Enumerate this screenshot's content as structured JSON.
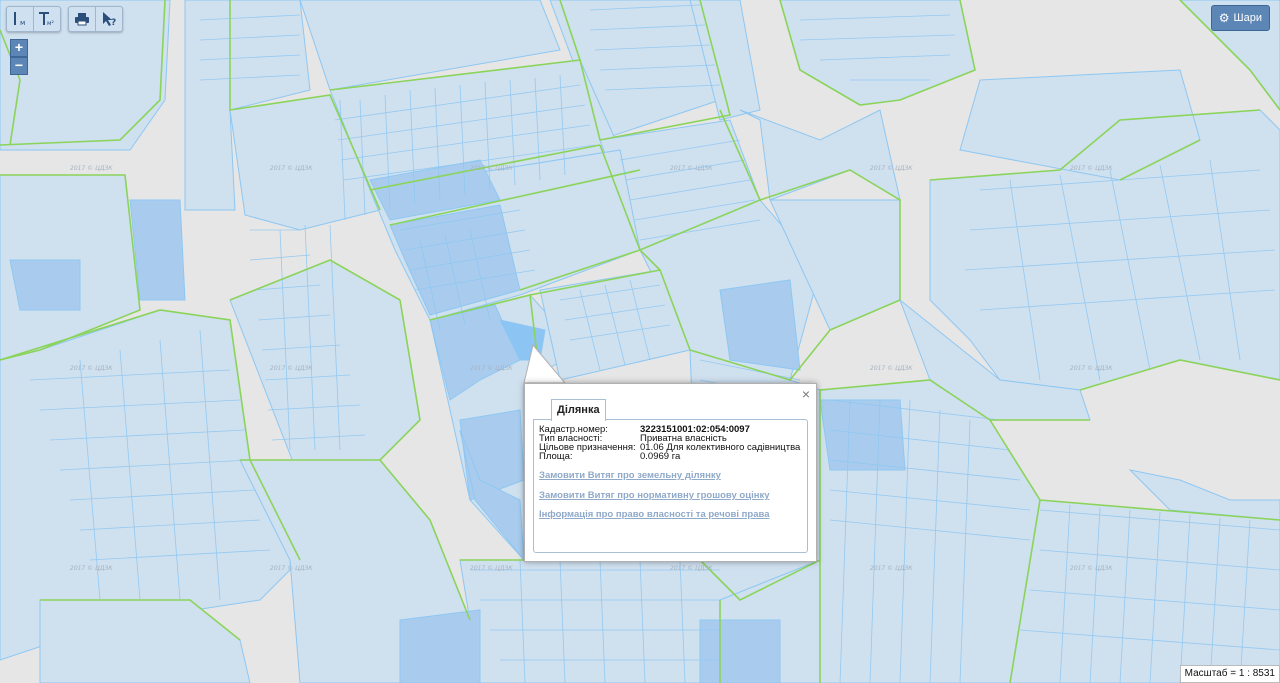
{
  "toolbar": {
    "group1": [
      {
        "icon": "ruler-meters-icon",
        "text": "м"
      },
      {
        "icon": "area-measure-icon",
        "text": "м²"
      }
    ],
    "group2": [
      {
        "icon": "print-icon"
      },
      {
        "icon": "identify-help-icon",
        "text": "?"
      }
    ]
  },
  "zoom": {
    "in": "+",
    "out": "−"
  },
  "layers_button": {
    "icon": "gear-icon",
    "label": "Шари"
  },
  "popup": {
    "tab": "Ділянка",
    "close": "×",
    "fields": [
      {
        "label": "Кадастр.номер:",
        "value": "3223151001:02:054:0097"
      },
      {
        "label": "Тип власності:",
        "value": "Приватна власність"
      },
      {
        "label": "Цільове призначення:",
        "value": "01.06 Для колективного садівництва"
      },
      {
        "label": "Площа:",
        "value": "0.0969 га"
      }
    ],
    "links": [
      "Замовити Витяг про земельну ділянку",
      "Замовити Витяг про нормативну грошову оцінку",
      "Інформація про право власності та речові права"
    ]
  },
  "scale": "Масштаб = 1 : 8531",
  "watermark": "2017 © ЦДЗК",
  "colors": {
    "parcel": "#cfe0ef",
    "parcel_dark": "#a9ccee",
    "selected": "#8cc4f4",
    "road": "#e6e6e6",
    "boundary": "#8bd45a",
    "parcel_line": "#8ec7f2"
  }
}
